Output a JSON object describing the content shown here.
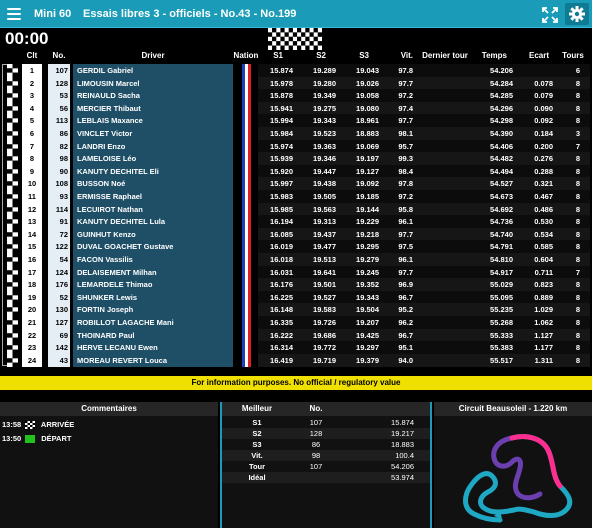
{
  "header": {
    "category": "Mini 60",
    "session": "Essais libres 3 - officiels - No.43 - No.199"
  },
  "clock": "00:00",
  "columns": {
    "pos": "Clt",
    "num": "No.",
    "driver": "Driver",
    "nation": "Nation",
    "s1": "S1",
    "s2": "S2",
    "s3": "S3",
    "vit": "Vit.",
    "last": "Dernier tour",
    "time": "Temps",
    "gap": "Ecart",
    "laps": "Tours"
  },
  "rows": [
    {
      "pos": "1",
      "num": "107",
      "driver": "GERDIL Gabriel",
      "s1": "15.874",
      "s2": "19.289",
      "s3": "19.043",
      "vit": "97.8",
      "time": "54.206",
      "gap": "",
      "laps": "6"
    },
    {
      "pos": "2",
      "num": "128",
      "driver": "LIMOUSIN Marcel",
      "s1": "15.978",
      "s2": "19.280",
      "s3": "19.026",
      "vit": "97.7",
      "time": "54.284",
      "gap": "0.078",
      "laps": "8"
    },
    {
      "pos": "3",
      "num": "53",
      "driver": "REINAULD Sacha",
      "s1": "15.878",
      "s2": "19.349",
      "s3": "19.058",
      "vit": "97.2",
      "time": "54.285",
      "gap": "0.079",
      "laps": "8"
    },
    {
      "pos": "4",
      "num": "56",
      "driver": "MERCIER Thibaut",
      "s1": "15.941",
      "s2": "19.275",
      "s3": "19.080",
      "vit": "97.4",
      "time": "54.296",
      "gap": "0.090",
      "laps": "8"
    },
    {
      "pos": "5",
      "num": "113",
      "driver": "LEBLAIS Maxance",
      "s1": "15.994",
      "s2": "19.343",
      "s3": "18.961",
      "vit": "97.7",
      "time": "54.298",
      "gap": "0.092",
      "laps": "8"
    },
    {
      "pos": "6",
      "num": "86",
      "driver": "VINCLET Victor",
      "s1": "15.984",
      "s2": "19.523",
      "s3": "18.883",
      "vit": "98.1",
      "time": "54.390",
      "gap": "0.184",
      "laps": "3"
    },
    {
      "pos": "7",
      "num": "82",
      "driver": "LANDRI Enzo",
      "s1": "15.974",
      "s2": "19.363",
      "s3": "19.069",
      "vit": "95.7",
      "time": "54.406",
      "gap": "0.200",
      "laps": "7"
    },
    {
      "pos": "8",
      "num": "98",
      "driver": "LAMELOISE Léo",
      "s1": "15.939",
      "s2": "19.346",
      "s3": "19.197",
      "vit": "99.3",
      "time": "54.482",
      "gap": "0.276",
      "laps": "8"
    },
    {
      "pos": "9",
      "num": "90",
      "driver": "KANUTY DECHITEL Eli",
      "s1": "15.920",
      "s2": "19.447",
      "s3": "19.127",
      "vit": "98.4",
      "time": "54.494",
      "gap": "0.288",
      "laps": "8"
    },
    {
      "pos": "10",
      "num": "108",
      "driver": "BUSSON Noé",
      "s1": "15.997",
      "s2": "19.438",
      "s3": "19.092",
      "vit": "97.8",
      "time": "54.527",
      "gap": "0.321",
      "laps": "8"
    },
    {
      "pos": "11",
      "num": "93",
      "driver": "ERMISSE Raphael",
      "s1": "15.983",
      "s2": "19.505",
      "s3": "19.185",
      "vit": "97.2",
      "time": "54.673",
      "gap": "0.467",
      "laps": "8"
    },
    {
      "pos": "12",
      "num": "114",
      "driver": "LECUIROT Nathan",
      "s1": "15.985",
      "s2": "19.563",
      "s3": "19.144",
      "vit": "95.8",
      "time": "54.692",
      "gap": "0.486",
      "laps": "8"
    },
    {
      "pos": "13",
      "num": "91",
      "driver": "KANUTY DECHITEL Lula",
      "s1": "16.194",
      "s2": "19.313",
      "s3": "19.229",
      "vit": "96.1",
      "time": "54.736",
      "gap": "0.530",
      "laps": "8"
    },
    {
      "pos": "14",
      "num": "72",
      "driver": "GUINHUT Kenzo",
      "s1": "16.085",
      "s2": "19.437",
      "s3": "19.218",
      "vit": "97.7",
      "time": "54.740",
      "gap": "0.534",
      "laps": "8"
    },
    {
      "pos": "15",
      "num": "122",
      "driver": "DUVAL GOACHET Gustave",
      "s1": "16.019",
      "s2": "19.477",
      "s3": "19.295",
      "vit": "97.5",
      "time": "54.791",
      "gap": "0.585",
      "laps": "8"
    },
    {
      "pos": "16",
      "num": "54",
      "driver": "FACON Vassilis",
      "s1": "16.018",
      "s2": "19.513",
      "s3": "19.279",
      "vit": "96.1",
      "time": "54.810",
      "gap": "0.604",
      "laps": "8"
    },
    {
      "pos": "17",
      "num": "124",
      "driver": "DELAISEMENT Milhan",
      "s1": "16.031",
      "s2": "19.641",
      "s3": "19.245",
      "vit": "97.7",
      "time": "54.917",
      "gap": "0.711",
      "laps": "7"
    },
    {
      "pos": "18",
      "num": "176",
      "driver": "LEMARDELE Thimao",
      "s1": "16.176",
      "s2": "19.501",
      "s3": "19.352",
      "vit": "96.9",
      "time": "55.029",
      "gap": "0.823",
      "laps": "8"
    },
    {
      "pos": "19",
      "num": "52",
      "driver": "SHUNKER Lewis",
      "s1": "16.225",
      "s2": "19.527",
      "s3": "19.343",
      "vit": "96.7",
      "time": "55.095",
      "gap": "0.889",
      "laps": "8"
    },
    {
      "pos": "20",
      "num": "130",
      "driver": "FORTIN Joseph",
      "s1": "16.148",
      "s2": "19.583",
      "s3": "19.504",
      "vit": "95.2",
      "time": "55.235",
      "gap": "1.029",
      "laps": "8"
    },
    {
      "pos": "21",
      "num": "127",
      "driver": "ROBILLOT LAGACHE Mani",
      "s1": "16.335",
      "s2": "19.726",
      "s3": "19.207",
      "vit": "96.2",
      "time": "55.268",
      "gap": "1.062",
      "laps": "8"
    },
    {
      "pos": "22",
      "num": "69",
      "driver": "THOINARD Paul",
      "s1": "16.222",
      "s2": "19.686",
      "s3": "19.425",
      "vit": "96.7",
      "time": "55.333",
      "gap": "1.127",
      "laps": "8"
    },
    {
      "pos": "23",
      "num": "142",
      "driver": "HERVE LECANU Ewen",
      "s1": "16.314",
      "s2": "19.772",
      "s3": "19.297",
      "vit": "95.1",
      "time": "55.383",
      "gap": "1.177",
      "laps": "8"
    },
    {
      "pos": "24",
      "num": "43",
      "driver": "MOREAU REVERT Louca",
      "s1": "16.419",
      "s2": "19.719",
      "s3": "19.379",
      "vit": "94.0",
      "time": "55.517",
      "gap": "1.311",
      "laps": "8"
    }
  ],
  "banner": "For information purposes. No official / regulatory value",
  "comments": {
    "title": "Commentaires",
    "items": [
      {
        "time": "13:58",
        "text": "ARRIVÉE",
        "icon": "checkered-flag-icon"
      },
      {
        "time": "13:50",
        "text": "DÉPART",
        "icon": "green-flag-icon"
      }
    ]
  },
  "best": {
    "title_label": "Meilleur",
    "title_num": "No.",
    "rows": [
      {
        "label": "S1",
        "num": "107",
        "value": "15.874"
      },
      {
        "label": "S2",
        "num": "128",
        "value": "19.217"
      },
      {
        "label": "S3",
        "num": "86",
        "value": "18.883"
      },
      {
        "label": "Vit.",
        "num": "98",
        "value": "100.4"
      },
      {
        "label": "Tour",
        "num": "107",
        "value": "54.206"
      },
      {
        "label": "Idéal",
        "num": "",
        "value": "53.974"
      }
    ]
  },
  "circuit": {
    "title": "Circuit Beausoleil - 1.220 km"
  },
  "colors": {
    "accent": "#1a9cb8",
    "banner": "#f0e000",
    "driver_bg": "#1f4f66"
  }
}
